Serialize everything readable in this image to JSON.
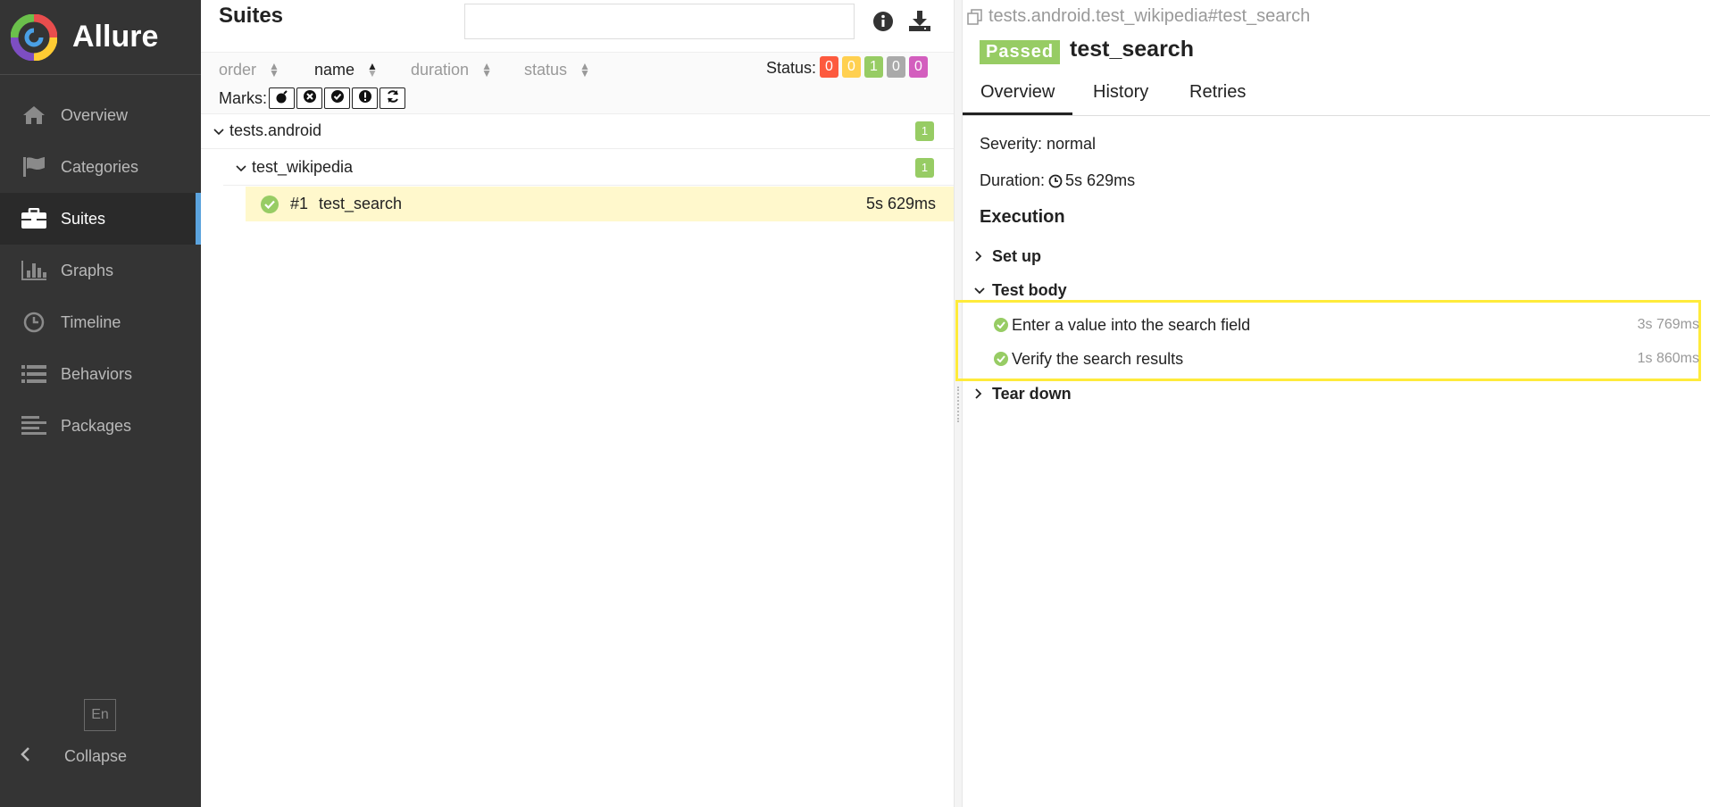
{
  "app": {
    "name": "Allure"
  },
  "sidebar": {
    "items": [
      {
        "label": "Overview",
        "icon": "home-icon"
      },
      {
        "label": "Categories",
        "icon": "flag-icon"
      },
      {
        "label": "Suites",
        "icon": "briefcase-icon",
        "active": true
      },
      {
        "label": "Graphs",
        "icon": "bar-chart-icon"
      },
      {
        "label": "Timeline",
        "icon": "clock-icon"
      },
      {
        "label": "Behaviors",
        "icon": "list-icon"
      },
      {
        "label": "Packages",
        "icon": "align-left-icon"
      }
    ],
    "language": "En",
    "collapse_label": "Collapse"
  },
  "suites": {
    "title": "Suites",
    "search_placeholder": "",
    "sorters": [
      "order",
      "name",
      "duration",
      "status"
    ],
    "active_sorter": "name",
    "status_label": "Status:",
    "status_counts": [
      {
        "value": "0",
        "color": "#fd5a3e"
      },
      {
        "value": "0",
        "color": "#ffd050"
      },
      {
        "value": "1",
        "color": "#97cc64"
      },
      {
        "value": "0",
        "color": "#aaaaaa"
      },
      {
        "value": "0",
        "color": "#d35ebe"
      }
    ],
    "marks_label": "Marks:",
    "tree": {
      "group": {
        "name": "tests.android",
        "count": "1"
      },
      "subgroup": {
        "name": "test_wikipedia",
        "count": "1"
      },
      "test": {
        "number": "#1",
        "name": "test_search",
        "duration": "5s 629ms"
      }
    }
  },
  "detail": {
    "path": "tests.android.test_wikipedia#test_search",
    "status": "Passed",
    "title": "test_search",
    "tabs": [
      "Overview",
      "History",
      "Retries"
    ],
    "severity": "Severity: normal",
    "duration_label": "Duration:",
    "duration": "5s 629ms",
    "execution_title": "Execution",
    "setup": "Set up",
    "test_body": "Test body",
    "steps": [
      {
        "name": "Enter a value into the search field",
        "duration": "3s 769ms"
      },
      {
        "name": "Verify the search results",
        "duration": "1s 860ms"
      }
    ],
    "teardown": "Tear down"
  }
}
